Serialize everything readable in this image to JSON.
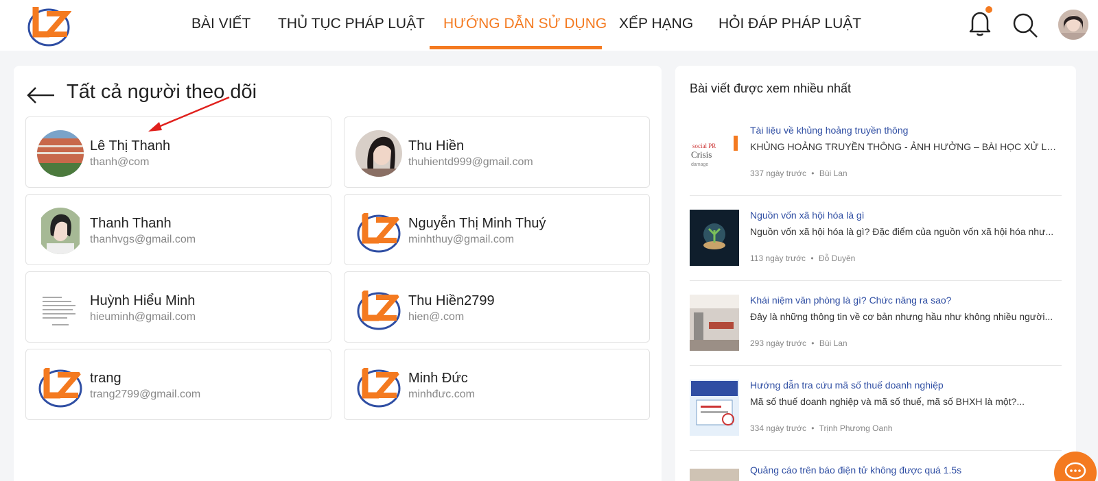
{
  "header": {
    "logo_text": "LEGAL ZONE",
    "nav": [
      "BÀI VIẾT",
      "THỦ TỤC PHÁP LUẬT",
      "HƯỚNG DẪN SỬ DỤNG",
      "XẾP HẠNG",
      "HỎI ĐÁP PHÁP LUẬT"
    ],
    "active_nav": "HƯỚNG DẪN SỬ DỤNG",
    "icons": [
      "bell-icon",
      "search-icon",
      "user-avatar"
    ]
  },
  "colors": {
    "accent": "#f47a20",
    "link": "#2f4ea3",
    "annotation": "#e0201c"
  },
  "main": {
    "title": "Tất cả người theo dõi",
    "followers": [
      {
        "name": "Lê Thị Thanh",
        "email": "thanh@com"
      },
      {
        "name": "Thu Hiền",
        "email": "thuhientd999@gmail.com"
      },
      {
        "name": "Thanh Thanh",
        "email": "thanhvgs@gmail.com"
      },
      {
        "name": "Nguyễn Thị Minh Thuý",
        "email": "minhthuy@gmail.com"
      },
      {
        "name": "Huỳnh Hiểu Minh",
        "email": "hieuminh@gmail.com"
      },
      {
        "name": "Thu Hiền2799",
        "email": "hien@.com"
      },
      {
        "name": "trang",
        "email": "trang2799@gmail.com"
      },
      {
        "name": "Minh Đức",
        "email": "minhđưc.com"
      }
    ]
  },
  "sidebar": {
    "title": "Bài viết được xem nhiều nhất",
    "articles": [
      {
        "title": "Tài liệu về khủng hoảng truyền thông",
        "excerpt": "KHỦNG HOẢNG TRUYỀN THÔNG - ẢNH HƯỞNG – BÀI HỌC XỬ LÝ ...",
        "time": "337 ngày trước",
        "author": "Bùi Lan"
      },
      {
        "title": "Nguồn vốn xã hội hóa là gì",
        "excerpt": "Nguồn vốn xã hội hóa là gì? Đặc điểm của nguồn vốn xã hội hóa như...",
        "time": "113 ngày trước",
        "author": "Đỗ Duyên"
      },
      {
        "title": "Khái niệm văn phòng là gì? Chức năng ra sao?",
        "excerpt": "Đây là những thông tin về cơ bản nhưng hầu như không nhiều người...",
        "time": "293 ngày trước",
        "author": "Bùi Lan"
      },
      {
        "title": "Hướng dẫn tra cứu mã số thuế doanh nghiệp",
        "excerpt": "Mã số thuế doanh nghiệp và mã số thuế, mã số BHXH là một?...",
        "time": "334 ngày trước",
        "author": "Trịnh Phương Oanh"
      },
      {
        "title": "Quảng cáo trên báo điện tử không được quá 1.5s",
        "excerpt": "",
        "time": "",
        "author": ""
      }
    ],
    "meta_separator": "•"
  }
}
